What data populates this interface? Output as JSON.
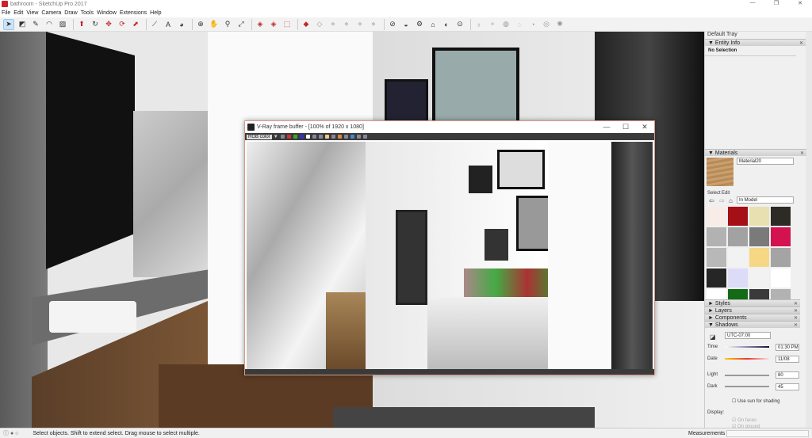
{
  "window": {
    "title": "bathroom - SketchUp Pro 2017",
    "controls": [
      "—",
      "❐",
      "✕"
    ]
  },
  "menu": [
    "File",
    "Edit",
    "View",
    "Camera",
    "Draw",
    "Tools",
    "Window",
    "Extensions",
    "Help"
  ],
  "toolbar": [
    {
      "name": "select",
      "glyph": "➤",
      "sel": true
    },
    {
      "name": "eraser",
      "glyph": "◩"
    },
    {
      "name": "line",
      "glyph": "✎"
    },
    {
      "name": "arc",
      "glyph": "◠"
    },
    {
      "name": "rectangle",
      "glyph": "▨"
    },
    "|",
    {
      "name": "push-pull",
      "glyph": "⬆"
    },
    {
      "name": "follow-me",
      "glyph": "↻"
    },
    {
      "name": "move",
      "glyph": "✥"
    },
    {
      "name": "rotate",
      "glyph": "⟳"
    },
    {
      "name": "scale",
      "glyph": "⬈"
    },
    "|",
    {
      "name": "tape-measure",
      "glyph": "⟋"
    },
    {
      "name": "text",
      "glyph": "A"
    },
    {
      "name": "paint-bucket",
      "glyph": "◕"
    },
    "|",
    {
      "name": "orbit",
      "glyph": "⊕"
    },
    {
      "name": "pan",
      "glyph": "✋"
    },
    {
      "name": "zoom",
      "glyph": "⚲"
    },
    {
      "name": "zoom-extents",
      "glyph": "⤢"
    },
    "|",
    {
      "name": "warehouse",
      "glyph": "◈"
    },
    {
      "name": "share-model",
      "glyph": "◈"
    },
    {
      "name": "send-layout",
      "glyph": "⬚"
    },
    "|",
    {
      "name": "extension-warehouse",
      "glyph": "◆"
    },
    {
      "name": "section",
      "glyph": "◇"
    },
    {
      "name": "section2",
      "glyph": "⋄"
    },
    {
      "name": "section3",
      "glyph": "⋄"
    },
    {
      "name": "section4",
      "glyph": "⋄"
    },
    {
      "name": "section5",
      "glyph": "⋄"
    },
    "|",
    {
      "name": "vray-1",
      "glyph": "⊘"
    },
    {
      "name": "vray-2",
      "glyph": "◒"
    },
    {
      "name": "vray-3",
      "glyph": "⚙"
    },
    {
      "name": "vray-4",
      "glyph": "⌂"
    },
    {
      "name": "vray-5",
      "glyph": "◐"
    },
    {
      "name": "vray-6",
      "glyph": "⊙"
    },
    "|",
    {
      "name": "light-1",
      "glyph": "♁"
    },
    {
      "name": "light-2",
      "glyph": "⚬"
    },
    {
      "name": "light-3",
      "glyph": "◍"
    },
    {
      "name": "light-4",
      "glyph": "◌"
    },
    {
      "name": "light-5",
      "glyph": "◔"
    },
    {
      "name": "light-6",
      "glyph": "◎"
    },
    {
      "name": "light-7",
      "glyph": "✺"
    }
  ],
  "vray": {
    "title": "V-Ray frame buffer - [100% of 1920 x 1080]",
    "channel": "RGB color",
    "controls": [
      "—",
      "☐",
      "✕"
    ]
  },
  "tray": {
    "title": "Default Tray",
    "entity_info": {
      "header": "Entity Info",
      "selection": "No Selection"
    },
    "materials": {
      "header": "Materials",
      "name": "Material20",
      "tab_select": "Select",
      "tab_edit": "Edit",
      "collection": "In Model",
      "swatches": [
        "#f8ece8",
        "#a50f16",
        "#e9e0b2",
        "#2e2a26",
        "#b2b2b2",
        "#a2a2a2",
        "#7a7a7a",
        "#d3124f",
        "#b8b8b8",
        "#f2f2f2",
        "#f6d884",
        "#a4a4a4",
        "#262626",
        "#dcdcf8",
        "#f2f2f2",
        "#ffffff",
        "#ffffff",
        "#136b16",
        "#3a3a3a",
        "#b2b2b2"
      ]
    },
    "collapsed": [
      "Styles",
      "Layers",
      "Components"
    ],
    "shadows": {
      "header": "Shadows",
      "timezone": "UTC-07:00",
      "time_label": "Time",
      "time": "01:30 PM",
      "date_label": "Date",
      "date": "11/08",
      "light_label": "Light",
      "light": "80",
      "dark_label": "Dark",
      "dark": "45",
      "use_sun": "Use sun for shading",
      "display_label": "Display:",
      "on_faces": "On faces",
      "on_ground": "On ground"
    }
  },
  "status": {
    "text": "Select objects. Shift to extend select. Drag mouse to select multiple.",
    "measurements": "Measurements"
  }
}
